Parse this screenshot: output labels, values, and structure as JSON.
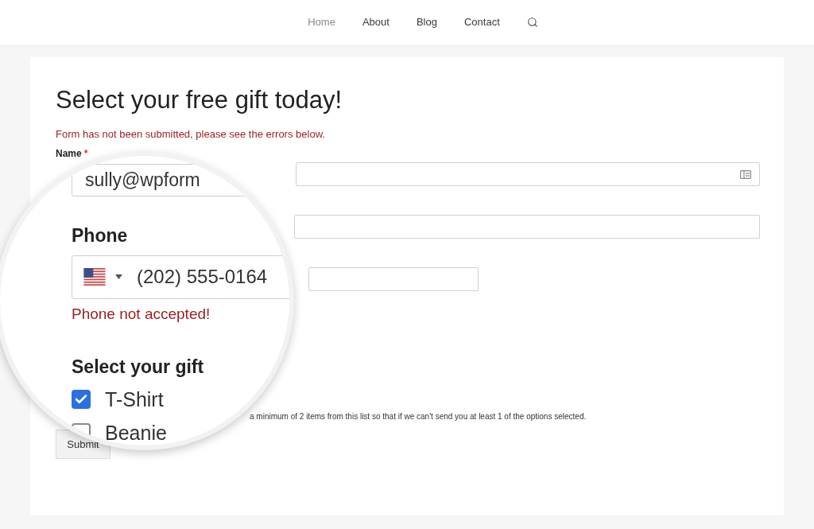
{
  "nav": {
    "items": [
      {
        "label": "Home",
        "selected": true
      },
      {
        "label": "About",
        "selected": false
      },
      {
        "label": "Blog",
        "selected": false
      },
      {
        "label": "Contact",
        "selected": false
      }
    ]
  },
  "page": {
    "title": "Select your free gift today!",
    "form_error": "Form has not been submitted, please see the errors below."
  },
  "form": {
    "name_label": "Name",
    "name_required_mark": "*",
    "gift_help": "a minimum of 2 items from this list so that if we can't send you at least 1 of the options selected.",
    "submit": "Submit"
  },
  "magnifier": {
    "email_value": "sully@wpform",
    "phone_label": "Phone",
    "phone_value": "(202) 555-0164",
    "phone_error": "Phone not accepted!",
    "gift_label": "Select your gift",
    "options": [
      {
        "label": "T-Shirt",
        "checked": true
      },
      {
        "label": "Beanie",
        "checked": false
      }
    ]
  }
}
